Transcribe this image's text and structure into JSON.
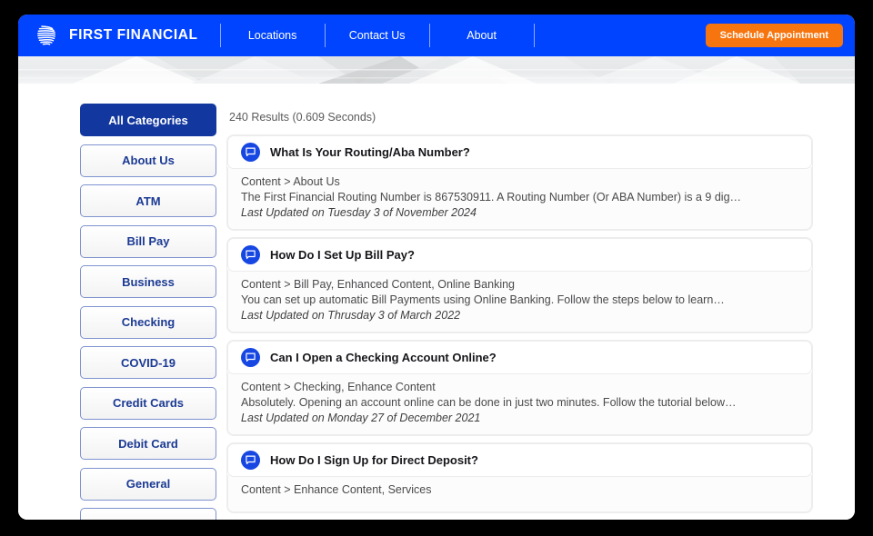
{
  "header": {
    "brand_name": "FIRST FINANCIAL",
    "brand_logo_icon": "swirl-globe-icon",
    "nav_links": [
      {
        "label": "Locations"
      },
      {
        "label": "Contact Us"
      },
      {
        "label": "About"
      }
    ],
    "cta_label": "Schedule Appointment",
    "cta_color": "#f7750f",
    "bar_color": "#0044ff"
  },
  "sidebar": {
    "items": [
      {
        "label": "All Categories",
        "active": true
      },
      {
        "label": "About Us",
        "active": false
      },
      {
        "label": "ATM",
        "active": false
      },
      {
        "label": "Bill Pay",
        "active": false
      },
      {
        "label": "Business",
        "active": false
      },
      {
        "label": "Checking",
        "active": false
      },
      {
        "label": "COVID-19",
        "active": false
      },
      {
        "label": "Credit Cards",
        "active": false
      },
      {
        "label": "Debit Card",
        "active": false
      },
      {
        "label": "General",
        "active": false
      },
      {
        "label": "",
        "active": false
      }
    ],
    "active_color": "#12379e",
    "border_color": "#7f93cf"
  },
  "results": {
    "count_text": "240 Results (0.609 Seconds)",
    "items": [
      {
        "icon": "comment-icon",
        "title": "What Is Your Routing/Aba Number?",
        "breadcrumb": "Content > About Us",
        "snippet": "The First Financial Routing Number is 867530911. A Routing Number (Or ABA Number) is a 9 dig…",
        "updated": "Last Updated on Tuesday 3 of November 2024"
      },
      {
        "icon": "comment-icon",
        "title": "How Do I Set Up Bill Pay?",
        "breadcrumb": "Content > Bill Pay, Enhanced Content, Online Banking",
        "snippet": "You can set up automatic Bill Payments using Online Banking. Follow the steps below to learn…",
        "updated": "Last Updated on Thrusday 3 of March 2022"
      },
      {
        "icon": "comment-icon",
        "title": "Can I Open a Checking Account Online?",
        "breadcrumb": "Content > Checking, Enhance Content",
        "snippet": "Absolutely. Opening an account online can be done in just two minutes. Follow the tutorial below…",
        "updated": "Last Updated on Monday 27 of December 2021"
      },
      {
        "icon": "comment-icon",
        "title": "How Do I Sign Up for Direct Deposit?",
        "breadcrumb": "Content > Enhance Content, Services",
        "snippet": "",
        "updated": ""
      }
    ]
  }
}
